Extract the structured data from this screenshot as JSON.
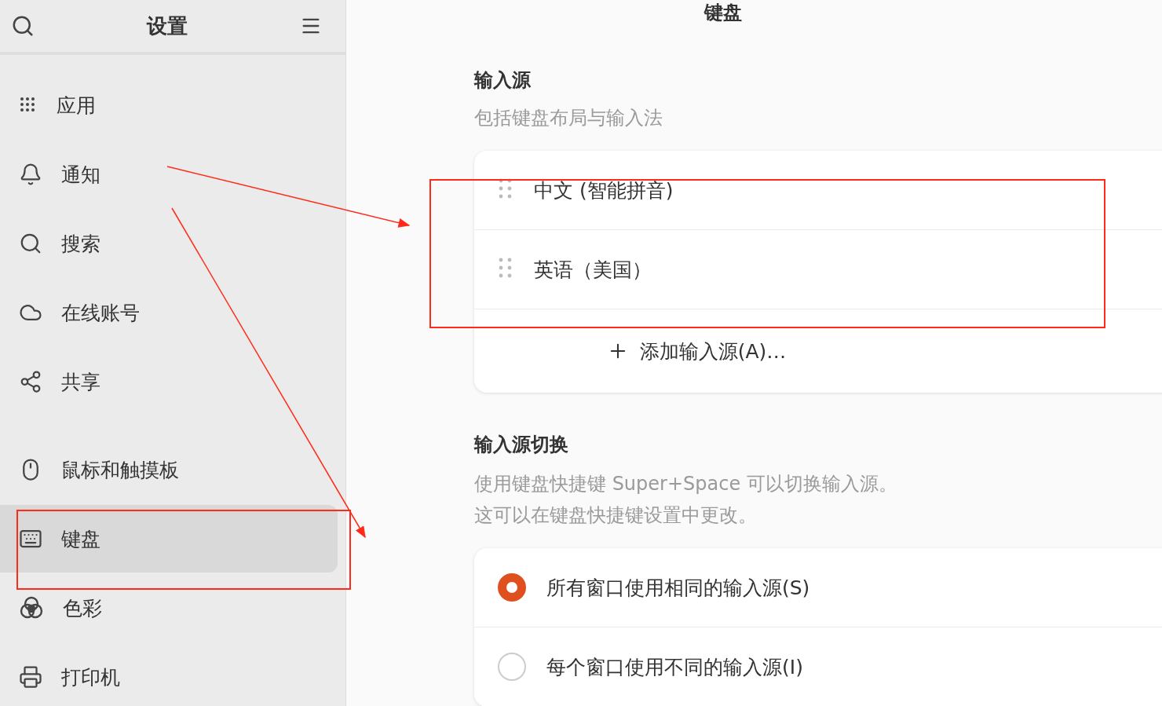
{
  "sidebar": {
    "title": "设置",
    "groups": [
      [
        {
          "label": "应用",
          "selected": false
        },
        {
          "label": "通知",
          "selected": false
        },
        {
          "label": "搜索",
          "selected": false
        },
        {
          "label": "在线账号",
          "selected": false
        },
        {
          "label": "共享",
          "selected": false
        }
      ],
      [
        {
          "label": "鼠标和触摸板",
          "selected": false
        },
        {
          "label": "键盘",
          "selected": true
        },
        {
          "label": "色彩",
          "selected": false
        },
        {
          "label": "打印机",
          "selected": false
        }
      ]
    ]
  },
  "main": {
    "title": "键盘",
    "input_sources": {
      "heading": "输入源",
      "subtitle": "包括键盘布局与输入法",
      "items": [
        "中文 (智能拼音)",
        "英语（美国）"
      ],
      "add_button": "添加输入源(A)…"
    },
    "switching": {
      "heading": "输入源切换",
      "description": [
        "使用键盘快捷键 Super+Space 可以切换输入源。",
        "这可以在键盘快捷键设置中更改。"
      ],
      "options": [
        {
          "label": "所有窗口使用相同的输入源(S)",
          "selected": true
        },
        {
          "label": "每个窗口使用不同的输入源(I)",
          "selected": false
        }
      ]
    }
  }
}
